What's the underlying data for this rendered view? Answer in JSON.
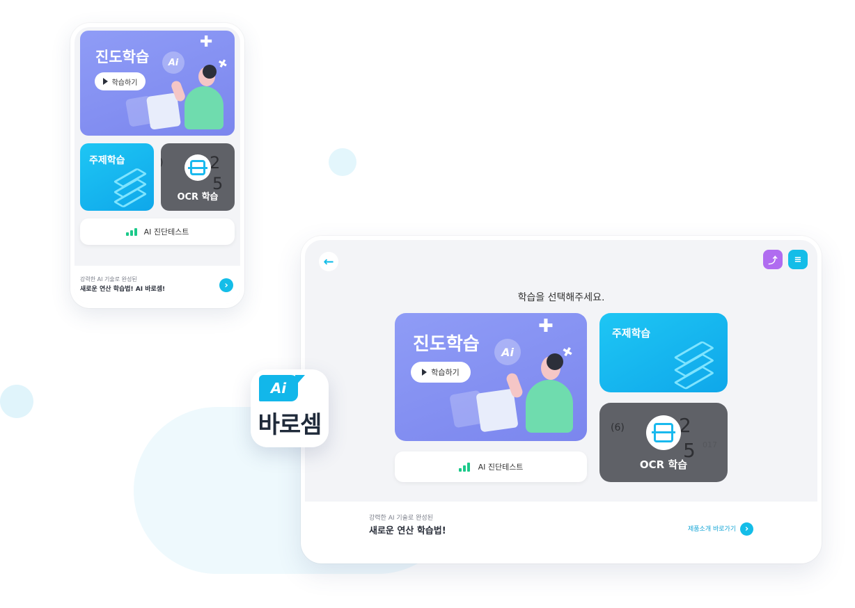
{
  "phone": {
    "main_card": {
      "title": "진도학습",
      "button": "학습하기",
      "ai_badge": "Ai"
    },
    "topic_card": {
      "title": "주제학습"
    },
    "ocr_card": {
      "title": "OCR 학습",
      "digits_top": "2",
      "digits_bottom": "5",
      "paren": ")"
    },
    "diag_card": {
      "label": "AI 진단테스트"
    },
    "footer": {
      "line1": "강력한 AI 기술로 완성된",
      "line2": "새로운 연산 학습법! AI 바로셈!",
      "arrow": "›"
    }
  },
  "tablet": {
    "back_icon": "←",
    "prompt": "학습을 선택해주세요.",
    "main_card": {
      "title": "진도학습",
      "button": "학습하기",
      "ai_badge": "Ai"
    },
    "topic_card": {
      "title": "주제학습"
    },
    "ocr_card": {
      "title": "OCR 학습",
      "paren": "(6)",
      "digits_top": "2",
      "digits_bottom": "5",
      "ghost": "017"
    },
    "diag_card": {
      "label": "AI 진단테스트"
    },
    "footer": {
      "line1": "강력한 AI 기술로 완성된",
      "line2": "새로운 연산 학습법!",
      "link": "제품소개 바로가기",
      "arrow": "›"
    },
    "icons": {
      "stats": "chart-icon",
      "menu": "menu-icon"
    }
  },
  "logo": {
    "tag": "Ai",
    "brand": "바로셈"
  },
  "colors": {
    "accent": "#14bde8",
    "main_card": "#8f9cf6",
    "topic_card": "#1ec6f4",
    "ocr_card": "#5f6167",
    "diag_green": "#1cc98a",
    "stats_btn": "#b06cf0"
  }
}
